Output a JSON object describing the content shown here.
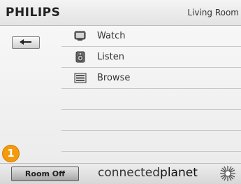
{
  "header": {
    "brand": "PHILIPS",
    "room": "Living Room"
  },
  "menu": [
    {
      "label": "Watch",
      "icon": "tv-icon"
    },
    {
      "label": "Listen",
      "icon": "speaker-icon"
    },
    {
      "label": "Browse",
      "icon": "list-icon"
    }
  ],
  "footer": {
    "room_off_label": "Room Off",
    "logo_light": "connected",
    "logo_bold": "planet"
  },
  "badge": "1",
  "colors": {
    "badge": "#f39a0e"
  }
}
